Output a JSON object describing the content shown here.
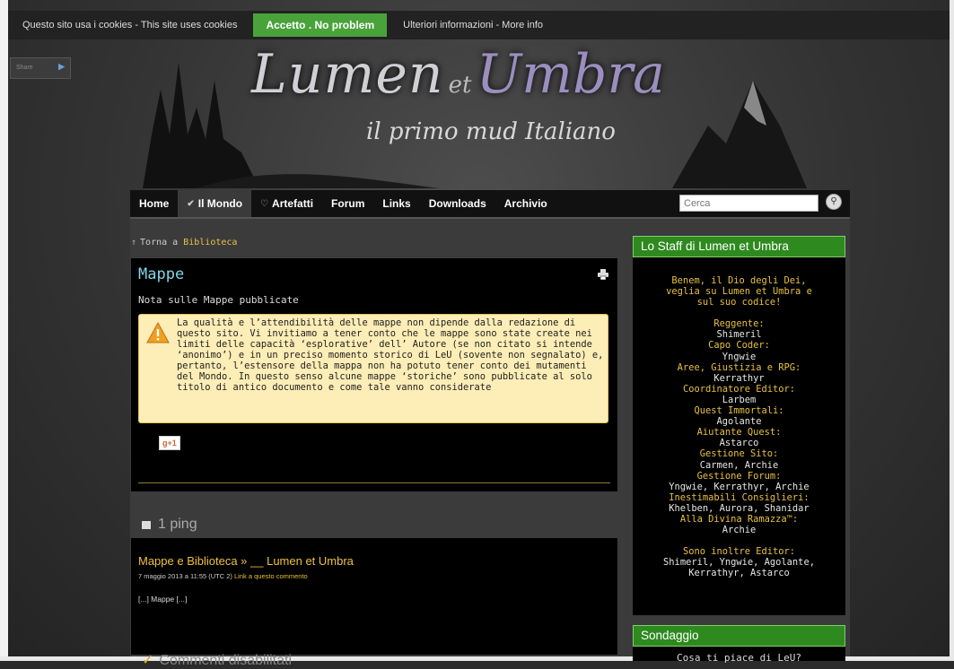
{
  "cookie_bar": {
    "text": "Questo sito usa i cookies - This site uses cookies",
    "accept_label": "Accetto . No problem",
    "more_info": "Ulteriori informazioni - More info"
  },
  "share": {
    "label": "Share"
  },
  "header": {
    "logo_part1": "Lumen",
    "logo_et": "et",
    "logo_part2": "Umbra",
    "tagline": "il primo mud Italiano"
  },
  "nav": {
    "items": [
      "Home",
      "Il Mondo",
      "Artefatti",
      "Forum",
      "Links",
      "Downloads",
      "Archivio"
    ],
    "active": "Il Mondo"
  },
  "search": {
    "placeholder": "Cerca"
  },
  "breadcrumb": {
    "prefix": "Torna a",
    "link": "Biblioteca"
  },
  "post": {
    "title": "Mappe",
    "subtitle": "Nota sulle Mappe pubblicate",
    "warning": "La qualità e l’attendibilità delle mappe non dipende dalla redazione di questo sito. Vi invitiamo a tener conto che le mappe sono state create nei limiti delle capacità ‘esplorative’ dell’ Autore (se non citato si intende ‘anonimo’) e in un preciso momento storico di LeU (sovente non segnalato) e, pertanto, l’estensore della mappa non ha potuto tener conto dei mutamenti del Mondo. In questo senso alcune mappe ‘storiche’ sono pubblicate al solo titolo di antico documento e come tale vanno considerate",
    "gplus_label": "g+1"
  },
  "pings": {
    "title": "1 ping",
    "link_text": "Mappe e Biblioteca » __ Lumen et Umbra",
    "date": "7 maggio 2013 a 11:55 (UTC 2)",
    "reply_link": "Link a questo commento",
    "excerpt": "[...] Mappe [...]"
  },
  "comments": {
    "closed_label": "Commenti disabilitati"
  },
  "staff_widget": {
    "title": "Lo Staff di Lumen et Umbra",
    "intro": [
      "Benem, il Dio degli Dei,",
      "veglia su Lumen et Umbra e",
      "sul suo codice!"
    ],
    "roles": [
      {
        "role": "Reggente:",
        "names": "Shimeril"
      },
      {
        "role": "Capo Coder:",
        "names": "Yngwie"
      },
      {
        "role": "Aree, Giustizia e RPG:",
        "names": "Kerrathyr"
      },
      {
        "role": "Coordinatore Editor:",
        "names": "Larbem"
      },
      {
        "role": "Quest Immortali:",
        "names": "Agolante"
      },
      {
        "role": "Aiutante Quest:",
        "names": "Astarco"
      },
      {
        "role": "Gestione Sito:",
        "names": "Carmen, Archie"
      },
      {
        "role": "Gestione Forum:",
        "names": "Yngwie, Kerrathyr, Archie"
      },
      {
        "role": "Inestimabili Consiglieri:",
        "names": "Khelben, Aurora, Shanidar"
      },
      {
        "role": "Alla Divina Ramazza™:",
        "names": "Archie"
      }
    ],
    "editors_label": "Sono inoltre Editor:",
    "editors": [
      "Shimeril, Yngwie, Agolante,",
      "Kerrathyr, Astarco"
    ]
  },
  "poll_widget": {
    "title": "Sondaggio",
    "question": "Cosa ti piace di LeU?"
  }
}
